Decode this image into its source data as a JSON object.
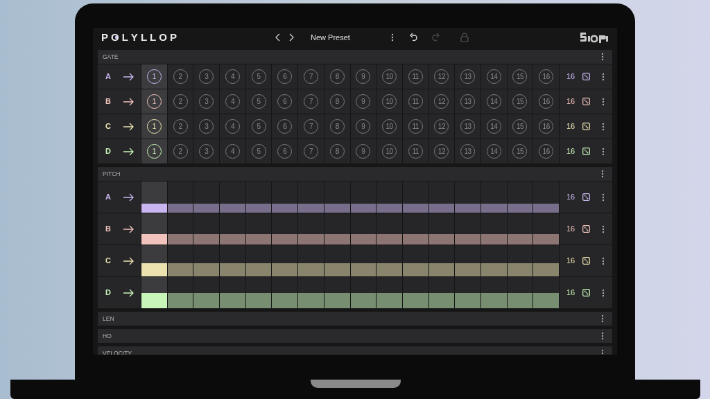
{
  "app": {
    "logo": "POLYLLOP",
    "preset": "New Preset",
    "undo_disabled": false,
    "redo_disabled": true,
    "locked": false
  },
  "sections": [
    {
      "title": "GATE",
      "kind": "gate",
      "rows": [
        {
          "label": "A",
          "color": "#c9b6f0",
          "length": "16",
          "steps": [
            {
              "label": "1",
              "selected": true
            },
            {
              "label": "2",
              "selected": false
            },
            {
              "label": "3",
              "selected": false
            },
            {
              "label": "4",
              "selected": false
            },
            {
              "label": "5",
              "selected": false
            },
            {
              "label": "6",
              "selected": false
            },
            {
              "label": "7",
              "selected": false
            },
            {
              "label": "8",
              "selected": false
            },
            {
              "label": "9",
              "selected": false
            },
            {
              "label": "10",
              "selected": false
            },
            {
              "label": "11",
              "selected": false
            },
            {
              "label": "12",
              "selected": false
            },
            {
              "label": "13",
              "selected": false
            },
            {
              "label": "14",
              "selected": false
            },
            {
              "label": "15",
              "selected": false
            },
            {
              "label": "16",
              "selected": false
            }
          ]
        },
        {
          "label": "B",
          "color": "#f2c3bc",
          "length": "16",
          "steps": [
            {
              "label": "1",
              "selected": true
            },
            {
              "label": "2",
              "selected": false
            },
            {
              "label": "3",
              "selected": false
            },
            {
              "label": "4",
              "selected": false
            },
            {
              "label": "5",
              "selected": false
            },
            {
              "label": "6",
              "selected": false
            },
            {
              "label": "7",
              "selected": false
            },
            {
              "label": "8",
              "selected": false
            },
            {
              "label": "9",
              "selected": false
            },
            {
              "label": "10",
              "selected": false
            },
            {
              "label": "11",
              "selected": false
            },
            {
              "label": "12",
              "selected": false
            },
            {
              "label": "13",
              "selected": false
            },
            {
              "label": "14",
              "selected": false
            },
            {
              "label": "15",
              "selected": false
            },
            {
              "label": "16",
              "selected": false
            }
          ]
        },
        {
          "label": "C",
          "color": "#ece2b0",
          "length": "16",
          "steps": [
            {
              "label": "1",
              "selected": true
            },
            {
              "label": "2",
              "selected": false
            },
            {
              "label": "3",
              "selected": false
            },
            {
              "label": "4",
              "selected": false
            },
            {
              "label": "5",
              "selected": false
            },
            {
              "label": "6",
              "selected": false
            },
            {
              "label": "7",
              "selected": false
            },
            {
              "label": "8",
              "selected": false
            },
            {
              "label": "9",
              "selected": false
            },
            {
              "label": "10",
              "selected": false
            },
            {
              "label": "11",
              "selected": false
            },
            {
              "label": "12",
              "selected": false
            },
            {
              "label": "13",
              "selected": false
            },
            {
              "label": "14",
              "selected": false
            },
            {
              "label": "15",
              "selected": false
            },
            {
              "label": "16",
              "selected": false
            }
          ]
        },
        {
          "label": "D",
          "color": "#c8f5b8",
          "length": "16",
          "steps": [
            {
              "label": "1",
              "selected": true
            },
            {
              "label": "2",
              "selected": false
            },
            {
              "label": "3",
              "selected": false
            },
            {
              "label": "4",
              "selected": false
            },
            {
              "label": "5",
              "selected": false
            },
            {
              "label": "6",
              "selected": false
            },
            {
              "label": "7",
              "selected": false
            },
            {
              "label": "8",
              "selected": false
            },
            {
              "label": "9",
              "selected": false
            },
            {
              "label": "10",
              "selected": false
            },
            {
              "label": "11",
              "selected": false
            },
            {
              "label": "12",
              "selected": false
            },
            {
              "label": "13",
              "selected": false
            },
            {
              "label": "14",
              "selected": false
            },
            {
              "label": "15",
              "selected": false
            },
            {
              "label": "16",
              "selected": false
            }
          ]
        }
      ]
    },
    {
      "title": "PITCH",
      "kind": "pitch",
      "rows": [
        {
          "label": "A",
          "color": "#c9b6f0",
          "length": "16",
          "level": 0.28,
          "steps": [
            {
              "selected": true
            },
            {
              "selected": false
            },
            {
              "selected": false
            },
            {
              "selected": false
            },
            {
              "selected": false
            },
            {
              "selected": false
            },
            {
              "selected": false
            },
            {
              "selected": false
            },
            {
              "selected": false
            },
            {
              "selected": false
            },
            {
              "selected": false
            },
            {
              "selected": false
            },
            {
              "selected": false
            },
            {
              "selected": false
            },
            {
              "selected": false
            },
            {
              "selected": false
            }
          ]
        },
        {
          "label": "B",
          "color": "#f2c3bc",
          "length": "16",
          "level": 0.34,
          "steps": [
            {
              "selected": true
            },
            {
              "selected": false
            },
            {
              "selected": false
            },
            {
              "selected": false
            },
            {
              "selected": false
            },
            {
              "selected": false
            },
            {
              "selected": false
            },
            {
              "selected": false
            },
            {
              "selected": false
            },
            {
              "selected": false
            },
            {
              "selected": false
            },
            {
              "selected": false
            },
            {
              "selected": false
            },
            {
              "selected": false
            },
            {
              "selected": false
            },
            {
              "selected": false
            }
          ]
        },
        {
          "label": "C",
          "color": "#ece2b0",
          "length": "16",
          "level": 0.42,
          "steps": [
            {
              "selected": true
            },
            {
              "selected": false
            },
            {
              "selected": false
            },
            {
              "selected": false
            },
            {
              "selected": false
            },
            {
              "selected": false
            },
            {
              "selected": false
            },
            {
              "selected": false
            },
            {
              "selected": false
            },
            {
              "selected": false
            },
            {
              "selected": false
            },
            {
              "selected": false
            },
            {
              "selected": false
            },
            {
              "selected": false
            },
            {
              "selected": false
            },
            {
              "selected": false
            }
          ]
        },
        {
          "label": "D",
          "color": "#c8f5b8",
          "length": "16",
          "level": 0.48,
          "steps": [
            {
              "selected": true
            },
            {
              "selected": false
            },
            {
              "selected": false
            },
            {
              "selected": false
            },
            {
              "selected": false
            },
            {
              "selected": false
            },
            {
              "selected": false
            },
            {
              "selected": false
            },
            {
              "selected": false
            },
            {
              "selected": false
            },
            {
              "selected": false
            },
            {
              "selected": false
            },
            {
              "selected": false
            },
            {
              "selected": false
            },
            {
              "selected": false
            },
            {
              "selected": false
            }
          ]
        }
      ]
    },
    {
      "title": "LEN",
      "kind": "collapsed"
    },
    {
      "title": "HO",
      "kind": "collapsed"
    },
    {
      "title": "VELOCITY",
      "kind": "collapsed"
    }
  ]
}
